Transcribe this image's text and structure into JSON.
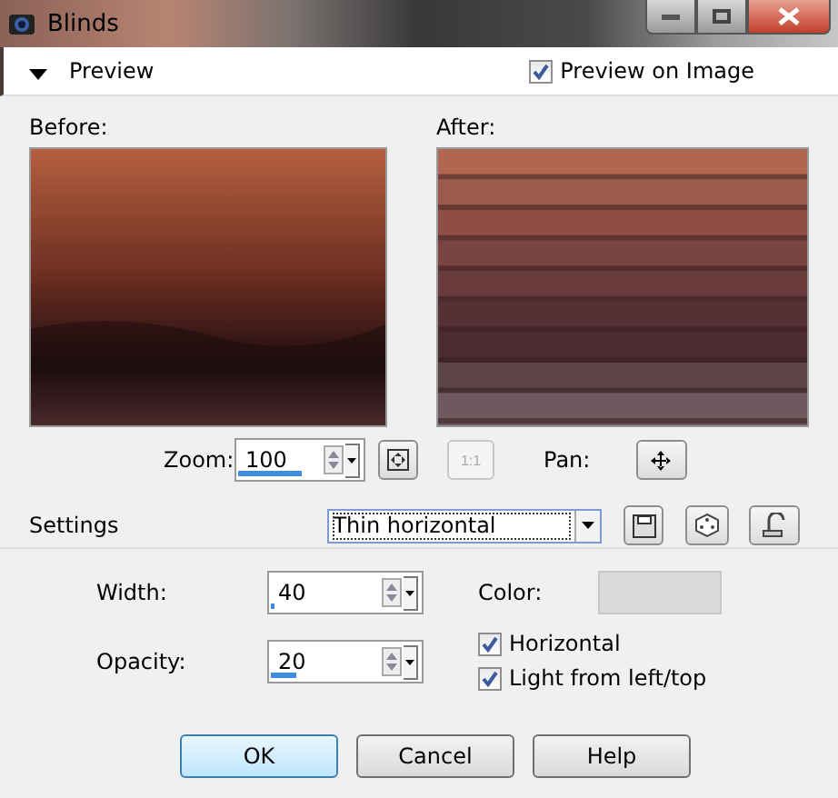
{
  "window": {
    "title": "Blinds"
  },
  "preview": {
    "label": "Preview",
    "expanded": true,
    "preview_on_image": {
      "label": "Preview on Image",
      "checked": true
    }
  },
  "before": {
    "label": "Before:"
  },
  "after": {
    "label": "After:"
  },
  "zoom": {
    "label": "Zoom:",
    "value": "100",
    "level": 0.52
  },
  "actual_size_button": {
    "label": "1:1",
    "disabled": true
  },
  "pan": {
    "label": "Pan:"
  },
  "settings": {
    "label": "Settings",
    "preset": "Thin horizontal"
  },
  "width": {
    "label": "Width:",
    "value": "40",
    "level": 0.02
  },
  "opacity": {
    "label": "Opacity:",
    "value": "20",
    "level": 0.17
  },
  "color": {
    "label": "Color:",
    "color": "#dcdada"
  },
  "options": [
    {
      "label": "Horizontal",
      "checked": true
    },
    {
      "label": "Light from left/top",
      "checked": true
    }
  ],
  "buttons": [
    {
      "label": "OK",
      "default": true
    },
    {
      "label": "Cancel",
      "default": false
    },
    {
      "label": "Help",
      "default": false
    }
  ]
}
